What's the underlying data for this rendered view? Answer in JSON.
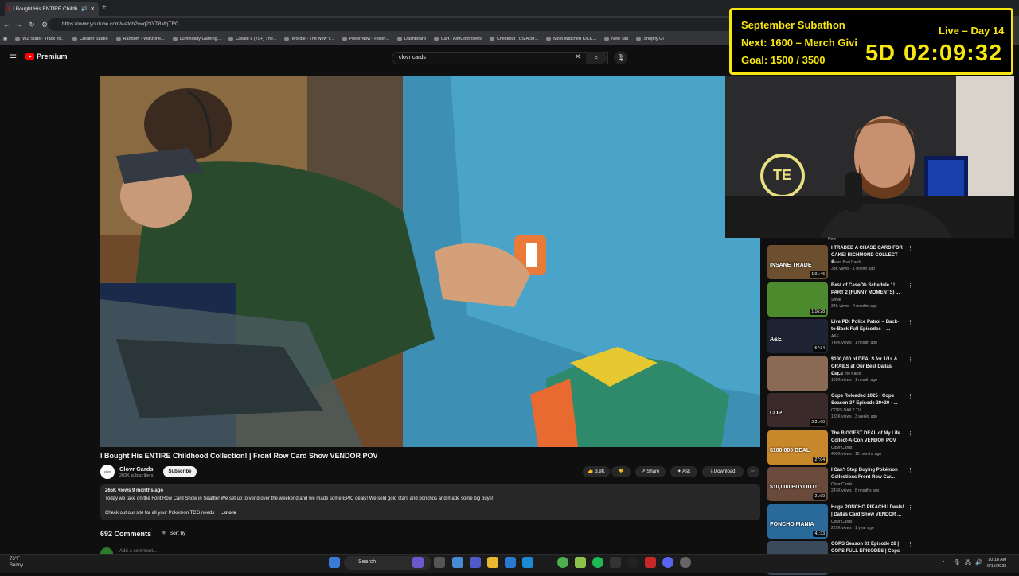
{
  "browser": {
    "tab_title": "I Bought His ENTIRE Childh",
    "url": "https://www.youtube.com/watch?v=q23YT8MqTR0",
    "bookmarks": [
      "WZ Stats - Track yo...",
      "Creator Studio",
      "Random - Warzone...",
      "Luminosity Gaming...",
      "Create a (70+) The...",
      "Wordle - The New Y...",
      "Poker Now - Poker...",
      "Dashboard",
      "Cart - AimControllers",
      "Checkout | US Acer...",
      "Most Watched KICK...",
      "New Tab",
      "Shopify Gi"
    ]
  },
  "youtube": {
    "logo_text": "Premium",
    "search_query": "clovr cards"
  },
  "overlay": {
    "title": "September Subathon",
    "next": "Next: 1600 – Merch Givi",
    "goal": "Goal: 1500 / 3500",
    "live": "Live – Day 14",
    "timer_days": "5D",
    "timer": "02:09:32"
  },
  "video": {
    "title": "I Bought His ENTIRE Childhood Collection! | Front Row Card Show VENDOR POV",
    "channel": "Clovr Cards",
    "channel_avatar": "clovr",
    "subs": "203K subscribers",
    "subscribe": "Subscribe",
    "likes": "3.9K",
    "share": "Share",
    "ask": "Ask",
    "download": "Download",
    "desc_meta": "265K views  9 months ago",
    "desc_line1": "Today we take on the Font Row Card Show in Seattle! We set up to vend over the weekend and we made some EPIC deals! We sold gold stars and ponchos and made some big buys!",
    "desc_line2": "Check out our site for all your Pokémon TCG needs",
    "desc_more": "...more",
    "comments": "692 Comments",
    "sort": "Sort by",
    "add_comment": "Add a comment..."
  },
  "sidebar": {
    "new_badge": "New",
    "items": [
      {
        "title": "I TRADED A CHASE CARD FOR\nCAKE! RICHMOND COLLECT A...",
        "channel": "Beard Bad Cards",
        "meta": "33K views · 1 month ago",
        "duration": "1:01:46",
        "color": "#6b4f2e",
        "tag": "INSANE TRADE"
      },
      {
        "title": "Best of CaseOh Schedule 1!\nPART 2 (FUNNY MOMENTS) ...",
        "channel": "Smile",
        "meta": "34K views · 4 months ago",
        "duration": "1:16:28",
        "color": "#4d8a2d",
        "tag": ""
      },
      {
        "title": "Live PD: Police Patrol – Back-\nto-Back Full Episodes – ...",
        "channel": "A&E",
        "meta": "746K views · 1 month ago",
        "duration": "57:34",
        "color": "#1e2433",
        "tag": "A&E"
      },
      {
        "title": "$100,000 of DEALS for 1/1s &\nGRAILS at Our Best Dallas Car...",
        "channel": "King of the Kards",
        "meta": "131K views · 1 month ago",
        "duration": "",
        "color": "#8a6a55",
        "tag": ""
      },
      {
        "title": "Cops Reloaded 2025 - Cops\nSeason 37 Episode 29+30 - ...",
        "channel": "COPS DAILY TV",
        "meta": "183K views · 3 weeks ago",
        "duration": "2:21:00",
        "color": "#3a2a2a",
        "tag": "COP"
      },
      {
        "title": "The BIGGEST DEAL of My Life\nCollect-A-Con VENDOR POV",
        "channel": "Clovr Cards",
        "meta": "400K views · 10 months ago",
        "duration": "27:04",
        "color": "#c7872b",
        "tag": "$100,000 DEAL"
      },
      {
        "title": "I Can't Stop Buying Pokémon\nCollections Front Row Car...",
        "channel": "Clovr Cards",
        "meta": "247K views · 8 months ago",
        "duration": "21:00",
        "color": "#6a4a3a",
        "tag": "$10,000 BUYOUT!"
      },
      {
        "title": "Huge PONCHO PIKACHU Deals!\n| Dallas Card Show VENDOR ...",
        "channel": "Clovr Cards",
        "meta": "221K views · 1 year ago",
        "duration": "41:33",
        "color": "#2a6a9a",
        "tag": "PONCHO MANIA"
      },
      {
        "title": "COPS Season 31 Episode 28 |\nCOPS FULL EPISODES | Cops ...",
        "channel": "",
        "meta": "",
        "duration": "",
        "color": "#3a4a5a",
        "tag": ""
      }
    ]
  },
  "taskbar": {
    "temp": "73°F",
    "weather": "Sunny",
    "search": "Search",
    "time": "10:18 AM",
    "date": "9/15/2025"
  }
}
